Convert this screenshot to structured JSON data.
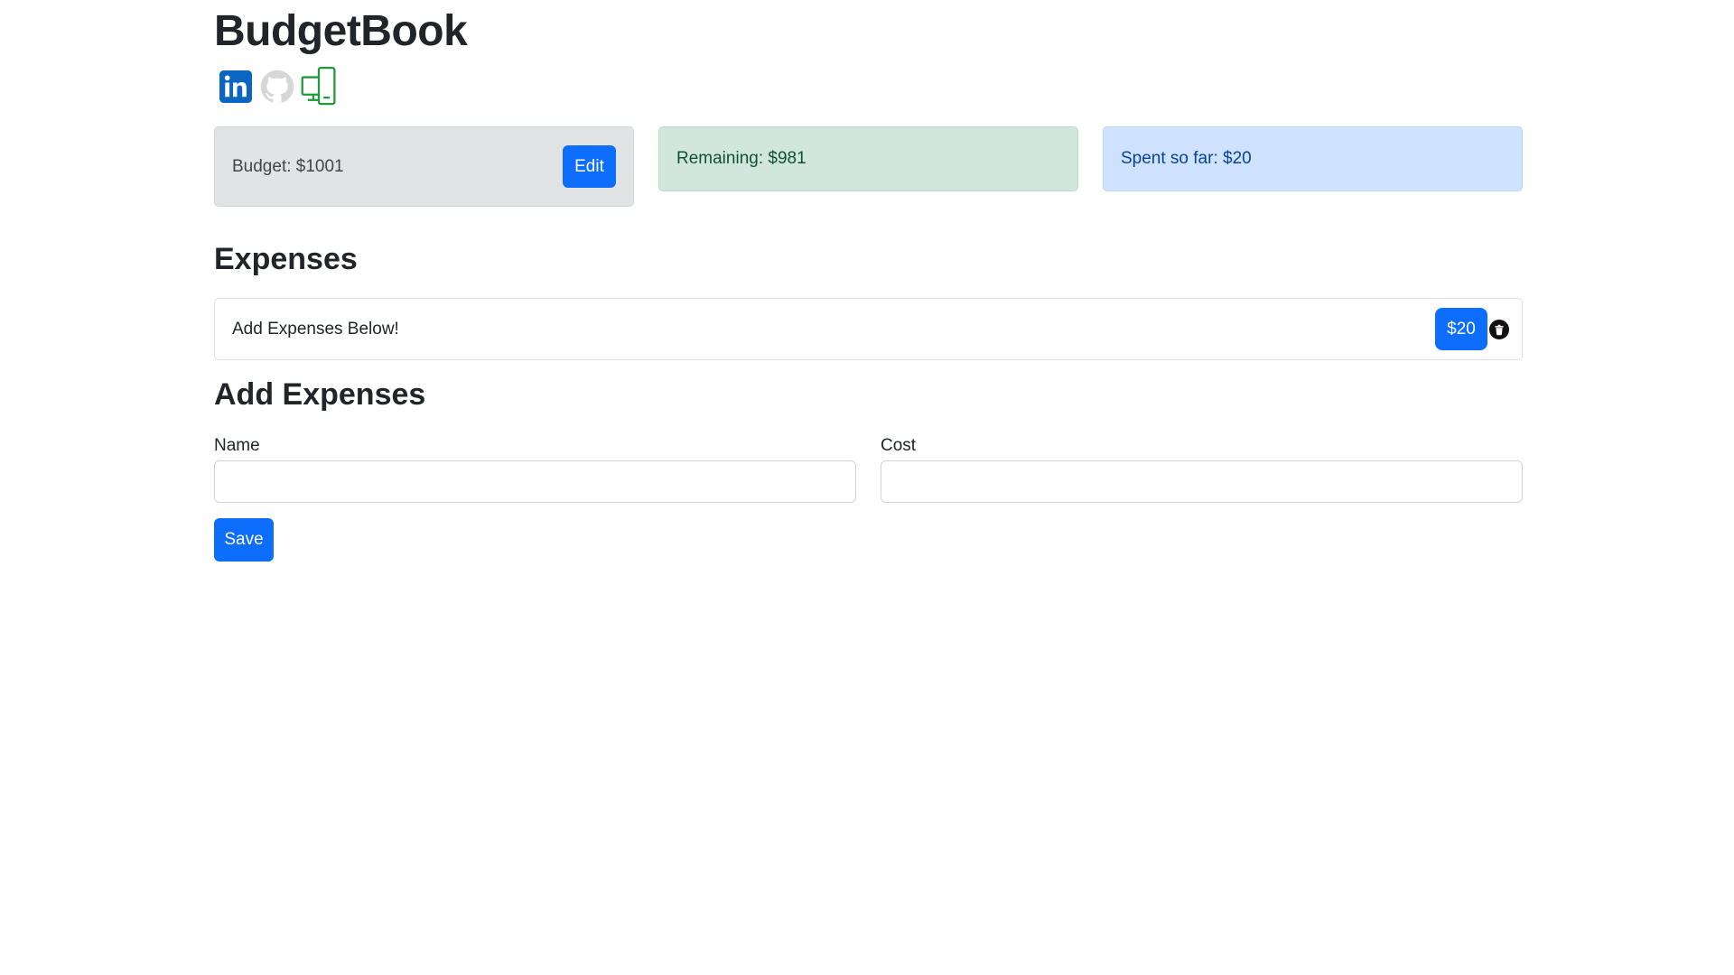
{
  "app": {
    "title": "BudgetBook"
  },
  "social": [
    {
      "icon": "linkedin-icon",
      "color": "#0a66c2"
    },
    {
      "icon": "github-icon",
      "color": "#d7d7d7"
    },
    {
      "icon": "devices-icon",
      "color": "#1e9a3a"
    }
  ],
  "summary": {
    "budget": "Budget: $1001",
    "edit_label": "Edit",
    "remaining": "Remaining: $981",
    "spent": "Spent so far: $20"
  },
  "expenses": {
    "title": "Expenses",
    "items": [
      {
        "name": "Add Expenses Below!",
        "cost": "$20",
        "delete_icon": "trash-icon"
      }
    ]
  },
  "add_form": {
    "title": "Add Expenses",
    "name_label": "Name",
    "name_value": "",
    "cost_label": "Cost",
    "cost_value": "",
    "save_label": "Save"
  },
  "colors": {
    "primary": "#0d6efd",
    "secondary_bg": "#e2e3e5",
    "success_bg": "#d1e7dd",
    "info_bg": "#cfe2ff"
  }
}
